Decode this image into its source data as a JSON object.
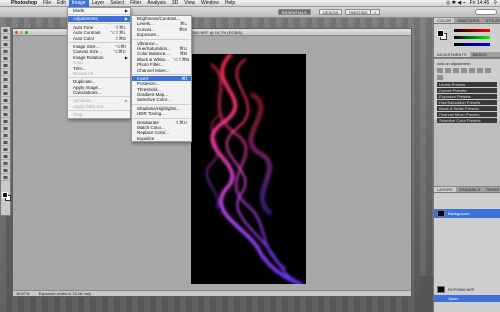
{
  "menubar": {
    "apple": "",
    "items": [
      "Photoshop",
      "File",
      "Edit",
      "Image",
      "Layer",
      "Select",
      "Filter",
      "Analysis",
      "3D",
      "View",
      "Window",
      "Help"
    ],
    "active": "Image",
    "clock": "Fri 14:45",
    "status_icons": "◎ ✱ ◀ ⌁"
  },
  "optbar": {
    "workspaces": [
      "ESSENTIALS",
      "DESIGN",
      "PAINTING",
      "»"
    ],
    "selected": "ESSENTIALS"
  },
  "image_menu": {
    "items": [
      {
        "label": "Mode",
        "submenu": true
      },
      {
        "sep": true
      },
      {
        "label": "Adjustments",
        "submenu": true,
        "highlight": true
      },
      {
        "sep": true
      },
      {
        "label": "Auto Tone",
        "shortcut": "⇧⌘L"
      },
      {
        "label": "Auto Contrast",
        "shortcut": "⌥⇧⌘L"
      },
      {
        "label": "Auto Color",
        "shortcut": "⇧⌘B"
      },
      {
        "sep": true
      },
      {
        "label": "Image Size...",
        "shortcut": "⌥⌘I"
      },
      {
        "label": "Canvas Size...",
        "shortcut": "⌥⌘C"
      },
      {
        "label": "Image Rotation",
        "submenu": true
      },
      {
        "label": "Crop",
        "disabled": true
      },
      {
        "label": "Trim..."
      },
      {
        "label": "Reveal All",
        "disabled": true
      },
      {
        "sep": true
      },
      {
        "label": "Duplicate..."
      },
      {
        "label": "Apply Image..."
      },
      {
        "label": "Calculations..."
      },
      {
        "sep": true
      },
      {
        "label": "Variables",
        "submenu": true,
        "disabled": true
      },
      {
        "label": "Apply Data Set...",
        "disabled": true
      },
      {
        "sep": true
      },
      {
        "label": "Trap...",
        "disabled": true
      }
    ]
  },
  "adjustments_menu": {
    "items": [
      {
        "label": "Brightness/Contrast..."
      },
      {
        "label": "Levels...",
        "shortcut": "⌘L"
      },
      {
        "label": "Curves...",
        "shortcut": "⌘M"
      },
      {
        "label": "Exposure..."
      },
      {
        "sep": true
      },
      {
        "label": "Vibrance..."
      },
      {
        "label": "Hue/Saturation...",
        "shortcut": "⌘U"
      },
      {
        "label": "Color Balance...",
        "shortcut": "⌘B"
      },
      {
        "label": "Black & White...",
        "shortcut": "⌥⇧⌘B"
      },
      {
        "label": "Photo Filter..."
      },
      {
        "label": "Channel Mixer..."
      },
      {
        "sep": true
      },
      {
        "label": "Invert",
        "shortcut": "⌘I",
        "highlight": true
      },
      {
        "label": "Posterize..."
      },
      {
        "label": "Threshold..."
      },
      {
        "label": "Gradient Map..."
      },
      {
        "label": "Selective Color..."
      },
      {
        "sep": true
      },
      {
        "label": "Shadows/Highlights..."
      },
      {
        "label": "HDR Toning..."
      },
      {
        "sep": true
      },
      {
        "label": "Desaturate",
        "shortcut": "⇧⌘U"
      },
      {
        "label": "Match Color..."
      },
      {
        "label": "Replace Color..."
      },
      {
        "label": "Equalize"
      }
    ]
  },
  "document": {
    "title": "RCP0560.NEF @ 16.7% (RGB/8)",
    "zoom": "16.67%",
    "status": "Exposure works in 32-bit only"
  },
  "right_panel": {
    "color_tabs": [
      "COLOR",
      "SWATCHES",
      "STYLES"
    ],
    "adjust_tabs": [
      "ADJUSTMENTS",
      "MASKS"
    ],
    "adjust_title": "Add an adjustment",
    "presets": [
      "Levels Presets",
      "Curves Presets",
      "Exposure Presets",
      "Hue/Saturation Presets",
      "Black & White Presets",
      "Channel Mixer Presets",
      "Selective Color Presets"
    ],
    "layers_tabs": [
      "LAYERS",
      "CHANNELS",
      "PATHS"
    ],
    "layer_name": "Background",
    "history_item": "RCP0560.NEF",
    "history_state": "Open"
  },
  "colors": {
    "accent": "#3d72d8",
    "smoke_pink": "#ff3fa0",
    "smoke_purple": "#b24bff"
  }
}
